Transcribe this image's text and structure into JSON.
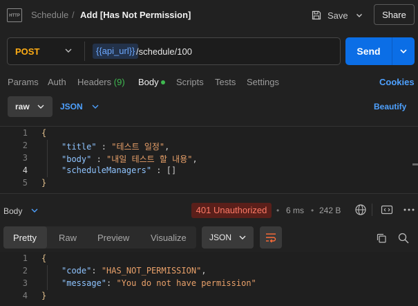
{
  "header": {
    "breadcrumb_parent": "Schedule",
    "breadcrumb_sep": "/",
    "title": "Add [Has Not Permission]",
    "save_label": "Save",
    "share_label": "Share",
    "http_badge": "HTTP"
  },
  "request": {
    "method": "POST",
    "url_variable": "{{api_url}}",
    "url_path": "/schedule/100",
    "send_label": "Send"
  },
  "tabs": {
    "params": "Params",
    "auth": "Auth",
    "headers": "Headers",
    "headers_count": "(9)",
    "body": "Body",
    "scripts": "Scripts",
    "tests": "Tests",
    "settings": "Settings",
    "cookies": "Cookies"
  },
  "body_options": {
    "mode": "raw",
    "language": "JSON",
    "beautify": "Beautify"
  },
  "request_body": {
    "lines": [
      {
        "n": "1",
        "open": "{"
      },
      {
        "n": "2",
        "key": "\"title\"",
        "sep": " : ",
        "value": "\"테스트 일정\"",
        "tail": ","
      },
      {
        "n": "3",
        "key": "\"body\"",
        "sep": " : ",
        "value": "\"내일 테스트 할 내용\"",
        "tail": ","
      },
      {
        "n": "4",
        "key": "\"scheduleManagers\"",
        "sep": " : ",
        "value": "[]",
        "tail": ""
      },
      {
        "n": "5",
        "close": "}"
      }
    ]
  },
  "response": {
    "label": "Body",
    "status": "401 Unauthorized",
    "time": "6 ms",
    "size": "242 B",
    "tabs": [
      "Pretty",
      "Raw",
      "Preview",
      "Visualize"
    ],
    "format": "JSON",
    "lines": [
      {
        "n": "1",
        "open": "{"
      },
      {
        "n": "2",
        "key": "\"code\"",
        "sep": ": ",
        "value": "\"HAS_NOT_PERMISSION\"",
        "tail": ","
      },
      {
        "n": "3",
        "key": "\"message\"",
        "sep": ": ",
        "value": "\"You do not have permission\"",
        "tail": ""
      },
      {
        "n": "4",
        "close": "}"
      }
    ]
  },
  "colors": {
    "accent": "#0b6ee6",
    "method": "#ffad14",
    "status_bg": "#5a1f1a",
    "status_text": "#ff7a66",
    "success_dot": "#3fb950"
  }
}
